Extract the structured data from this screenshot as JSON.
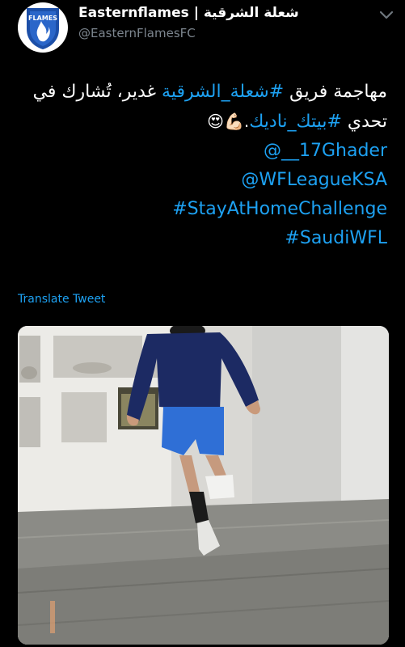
{
  "tweet": {
    "author": {
      "display_name": "Easternflames | شعلة الشرقية",
      "handle": "@EasternFlamesFC",
      "avatar_icon": "eastern-flames-logo-icon",
      "avatar_logo_text": "FLAMES"
    },
    "menu_icon": "chevron-down-icon",
    "text": {
      "line1_prefix": "مهاجمة فريق ",
      "line1_hashtag": "#شعلة_الشرقية",
      "line1_suffix": " غدير، تُشارك في",
      "line2_prefix": "تحدي ",
      "line2_hashtag": "#بيتك_ناديك",
      "line2_emoji": ".💪🏻😍",
      "mention1": "@__17Ghader",
      "mention2": "@WFLeagueKSA",
      "hashtag1": "#StayAtHomeChallenge",
      "hashtag2": "#SaudiWFL"
    },
    "translate_label": "Translate Tweet",
    "media": {
      "type": "video-still",
      "description_icon": "video-thumbnail"
    }
  },
  "colors": {
    "background": "#000000",
    "link": "#1da1f2",
    "handle": "#7c858e",
    "shorts": "#2f6fd6",
    "shirt": "#1c2a63"
  }
}
